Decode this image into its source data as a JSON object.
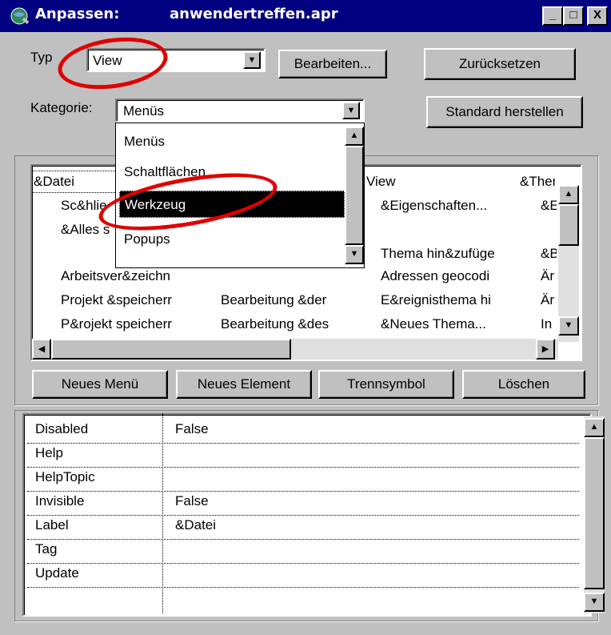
{
  "window": {
    "title_prefix": "Anpassen:",
    "title_file": "anwendertreffen.apr",
    "btn_minimize": "_",
    "btn_maximize": "□",
    "btn_close": "X"
  },
  "typ": {
    "label": "Typ",
    "value": "View"
  },
  "kategorie": {
    "label": "Kategorie:",
    "value": "Menüs"
  },
  "buttons": {
    "bearbeiten": "Bearbeiten...",
    "zuruecksetzen": "Zurücksetzen",
    "standard": "Standard herstellen",
    "neues_menu": "Neues Menü",
    "neues_element": "Neues Element",
    "trennsymbol": "Trennsymbol",
    "loeschen": "Löschen"
  },
  "dropdown": {
    "items": [
      "Menüs",
      "Schaltflächen",
      "Werkzeug",
      "Popups"
    ],
    "selected": "Werkzeug"
  },
  "menu_grid": {
    "headers": [
      "&Datei",
      "View",
      "&Ther"
    ],
    "rows": [
      [
        "Sc&hlie",
        "",
        "&Eigenschaften...",
        "&E"
      ],
      [
        "&Alles s",
        "",
        "",
        ""
      ],
      [
        "",
        "",
        "Thema hin&zufüge",
        "&B"
      ],
      [
        "Arbeitsver&zeichn",
        "",
        "Adressen geocodi",
        "Är"
      ],
      [
        "Projekt &speicherr",
        "Bearbeitung &der",
        "E&reignisthema hi",
        "Är"
      ],
      [
        "P&rojekt speicherr",
        "Bearbeitung &des",
        "&Neues Thema...",
        "In"
      ]
    ]
  },
  "properties": [
    {
      "name": "Disabled",
      "value": "False"
    },
    {
      "name": "Help",
      "value": ""
    },
    {
      "name": "HelpTopic",
      "value": ""
    },
    {
      "name": "Invisible",
      "value": "False"
    },
    {
      "name": "Label",
      "value": "&Datei"
    },
    {
      "name": "Tag",
      "value": ""
    },
    {
      "name": "Update",
      "value": ""
    }
  ],
  "icons": {
    "up": "▲",
    "down": "▼",
    "left": "◀",
    "right": "▶",
    "app": "globe-icon"
  },
  "colors": {
    "titlebar": "#000080",
    "face": "#c0c0c0",
    "highlight": "#e00000"
  }
}
